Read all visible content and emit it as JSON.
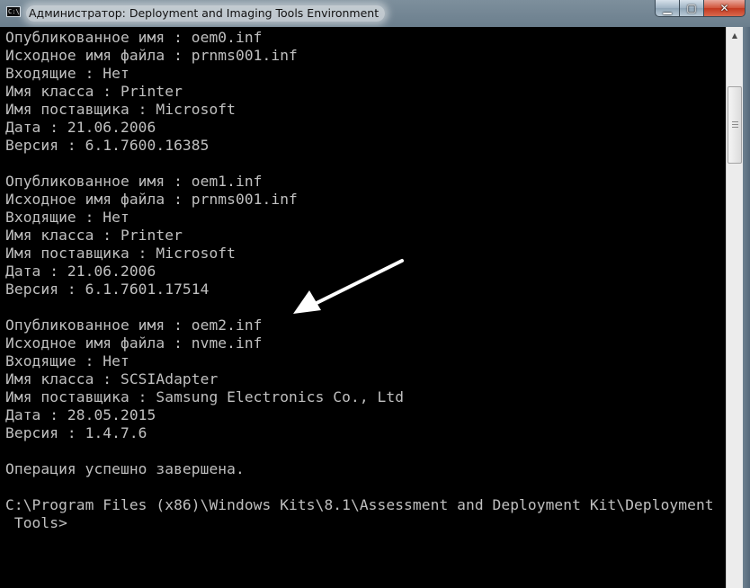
{
  "window": {
    "title": "Администратор: Deployment and Imaging Tools Environment",
    "icon": "console-icon",
    "controls": {
      "minimize_icon": "minimize-icon",
      "maximize_icon": "maximize-icon",
      "close_icon": "close-icon"
    }
  },
  "console": {
    "lines": [
      "Опубликованное имя : oem0.inf",
      "Исходное имя файла : prnms001.inf",
      "Входящие : Нет",
      "Имя класса : Printer",
      "Имя поставщика : Microsoft",
      "Дата : 21.06.2006",
      "Версия : 6.1.7600.16385",
      "",
      "Опубликованное имя : oem1.inf",
      "Исходное имя файла : prnms001.inf",
      "Входящие : Нет",
      "Имя класса : Printer",
      "Имя поставщика : Microsoft",
      "Дата : 21.06.2006",
      "Версия : 6.1.7601.17514",
      "",
      "Опубликованное имя : oem2.inf",
      "Исходное имя файла : nvme.inf",
      "Входящие : Нет",
      "Имя класса : SCSIAdapter",
      "Имя поставщика : Samsung Electronics Co., Ltd",
      "Дата : 28.05.2015",
      "Версия : 1.4.7.6",
      "",
      "Операция успешно завершена.",
      "",
      "C:\\Program Files (x86)\\Windows Kits\\8.1\\Assessment and Deployment Kit\\Deployment",
      " Tools>"
    ]
  },
  "annotation": {
    "icon": "arrow-icon",
    "color": "#ffffff"
  },
  "colors": {
    "console_bg": "#000000",
    "console_fg": "#c0c0c0"
  }
}
